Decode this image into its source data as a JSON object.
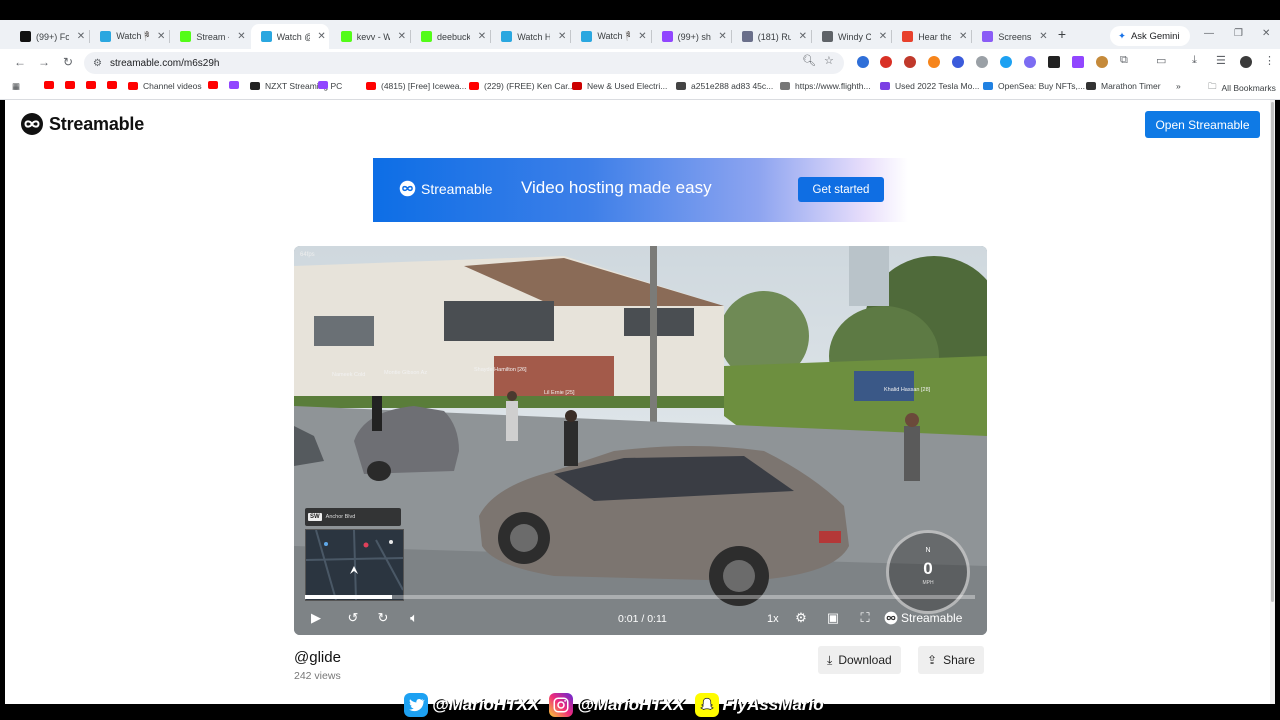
{
  "browser": {
    "tabs": [
      {
        "title": "(99+) Foll",
        "color": "#111111"
      },
      {
        "title": "Watch 🏁",
        "color": "#2aa7e0"
      },
      {
        "title": "Stream -",
        "color": "#53fc18"
      },
      {
        "title": "Watch @",
        "color": "#2aa7e0",
        "active": true
      },
      {
        "title": "kevv - W",
        "color": "#53fc18"
      },
      {
        "title": "deebuck",
        "color": "#53fc18"
      },
      {
        "title": "Watch H",
        "color": "#2aa7e0"
      },
      {
        "title": "Watch 🏁",
        "color": "#2aa7e0"
      },
      {
        "title": "(99+) sh",
        "color": "#9146ff"
      },
      {
        "title": "(181) Ru",
        "color": "#6a6f8a"
      },
      {
        "title": "Windy C",
        "color": "#5f6368"
      },
      {
        "title": "Hear the",
        "color": "#e8412c"
      },
      {
        "title": "Screensh",
        "color": "#8a5cf6"
      }
    ],
    "new_tab": "+",
    "gemini_label": "Ask Gemini",
    "url": "streamable.com/m6s29h",
    "bookmarks": [
      {
        "label": "",
        "color": "#ff0000"
      },
      {
        "label": "",
        "color": "#ff0000"
      },
      {
        "label": "",
        "color": "#ff0000"
      },
      {
        "label": "",
        "color": "#ff0000"
      },
      {
        "label": "Channel videos",
        "color": "#ff0000"
      },
      {
        "label": "",
        "color": "#ff0000"
      },
      {
        "label": "",
        "color": "#9146ff"
      },
      {
        "label": "NZXT Streaming PC",
        "color": "#222222"
      },
      {
        "label": "",
        "color": "#9146ff"
      },
      {
        "label": "(4815) [Free] Icewea...",
        "color": "#ff0000"
      },
      {
        "label": "(229) (FREE) Ken Car...",
        "color": "#ff0000"
      },
      {
        "label": "New & Used Electri...",
        "color": "#cc0000"
      },
      {
        "label": "a251e288 ad83 45c...",
        "color": "#444444"
      },
      {
        "label": "https://www.flighth...",
        "color": "#777777"
      },
      {
        "label": "Used 2022 Tesla Mo...",
        "color": "#7b3fe4"
      },
      {
        "label": "OpenSea: Buy NFTs,...",
        "color": "#2081e2"
      },
      {
        "label": "Marathon Timer",
        "color": "#333333"
      }
    ],
    "more_bookmarks": "»",
    "all_bookmarks": "All Bookmarks"
  },
  "site": {
    "logo_text": "Streamable",
    "open_button": "Open Streamable",
    "banner": {
      "logo_text": "Streamable",
      "tagline": "Video hosting made easy",
      "cta": "Get started"
    },
    "accent": "#0f7ae5"
  },
  "video": {
    "fps_overlay": "64fps",
    "hud_direction": "SW",
    "hud_street": "Anchor Blvd",
    "speed_value": "0",
    "speed_gear": "N",
    "speed_unit": "MPH",
    "player_tags": [
      "Nameek Cold",
      "Montie Gibson Az",
      "Shayde Hamilton [26]",
      "Lil Ernie [25]",
      "Khalid Hassan [28]"
    ],
    "current_time": "0:01",
    "duration": "0:11",
    "progress": 0.13,
    "playback_speed": "1x",
    "watermark": "Streamable"
  },
  "info": {
    "title": "@glide",
    "views": "242 views",
    "download_label": "Download",
    "share_label": "Share"
  },
  "overlay": {
    "twitter_handle": "@MarioHTXX",
    "instagram_handle": "@MarioHTXX",
    "snapchat_handle": "FlyAssMario"
  }
}
